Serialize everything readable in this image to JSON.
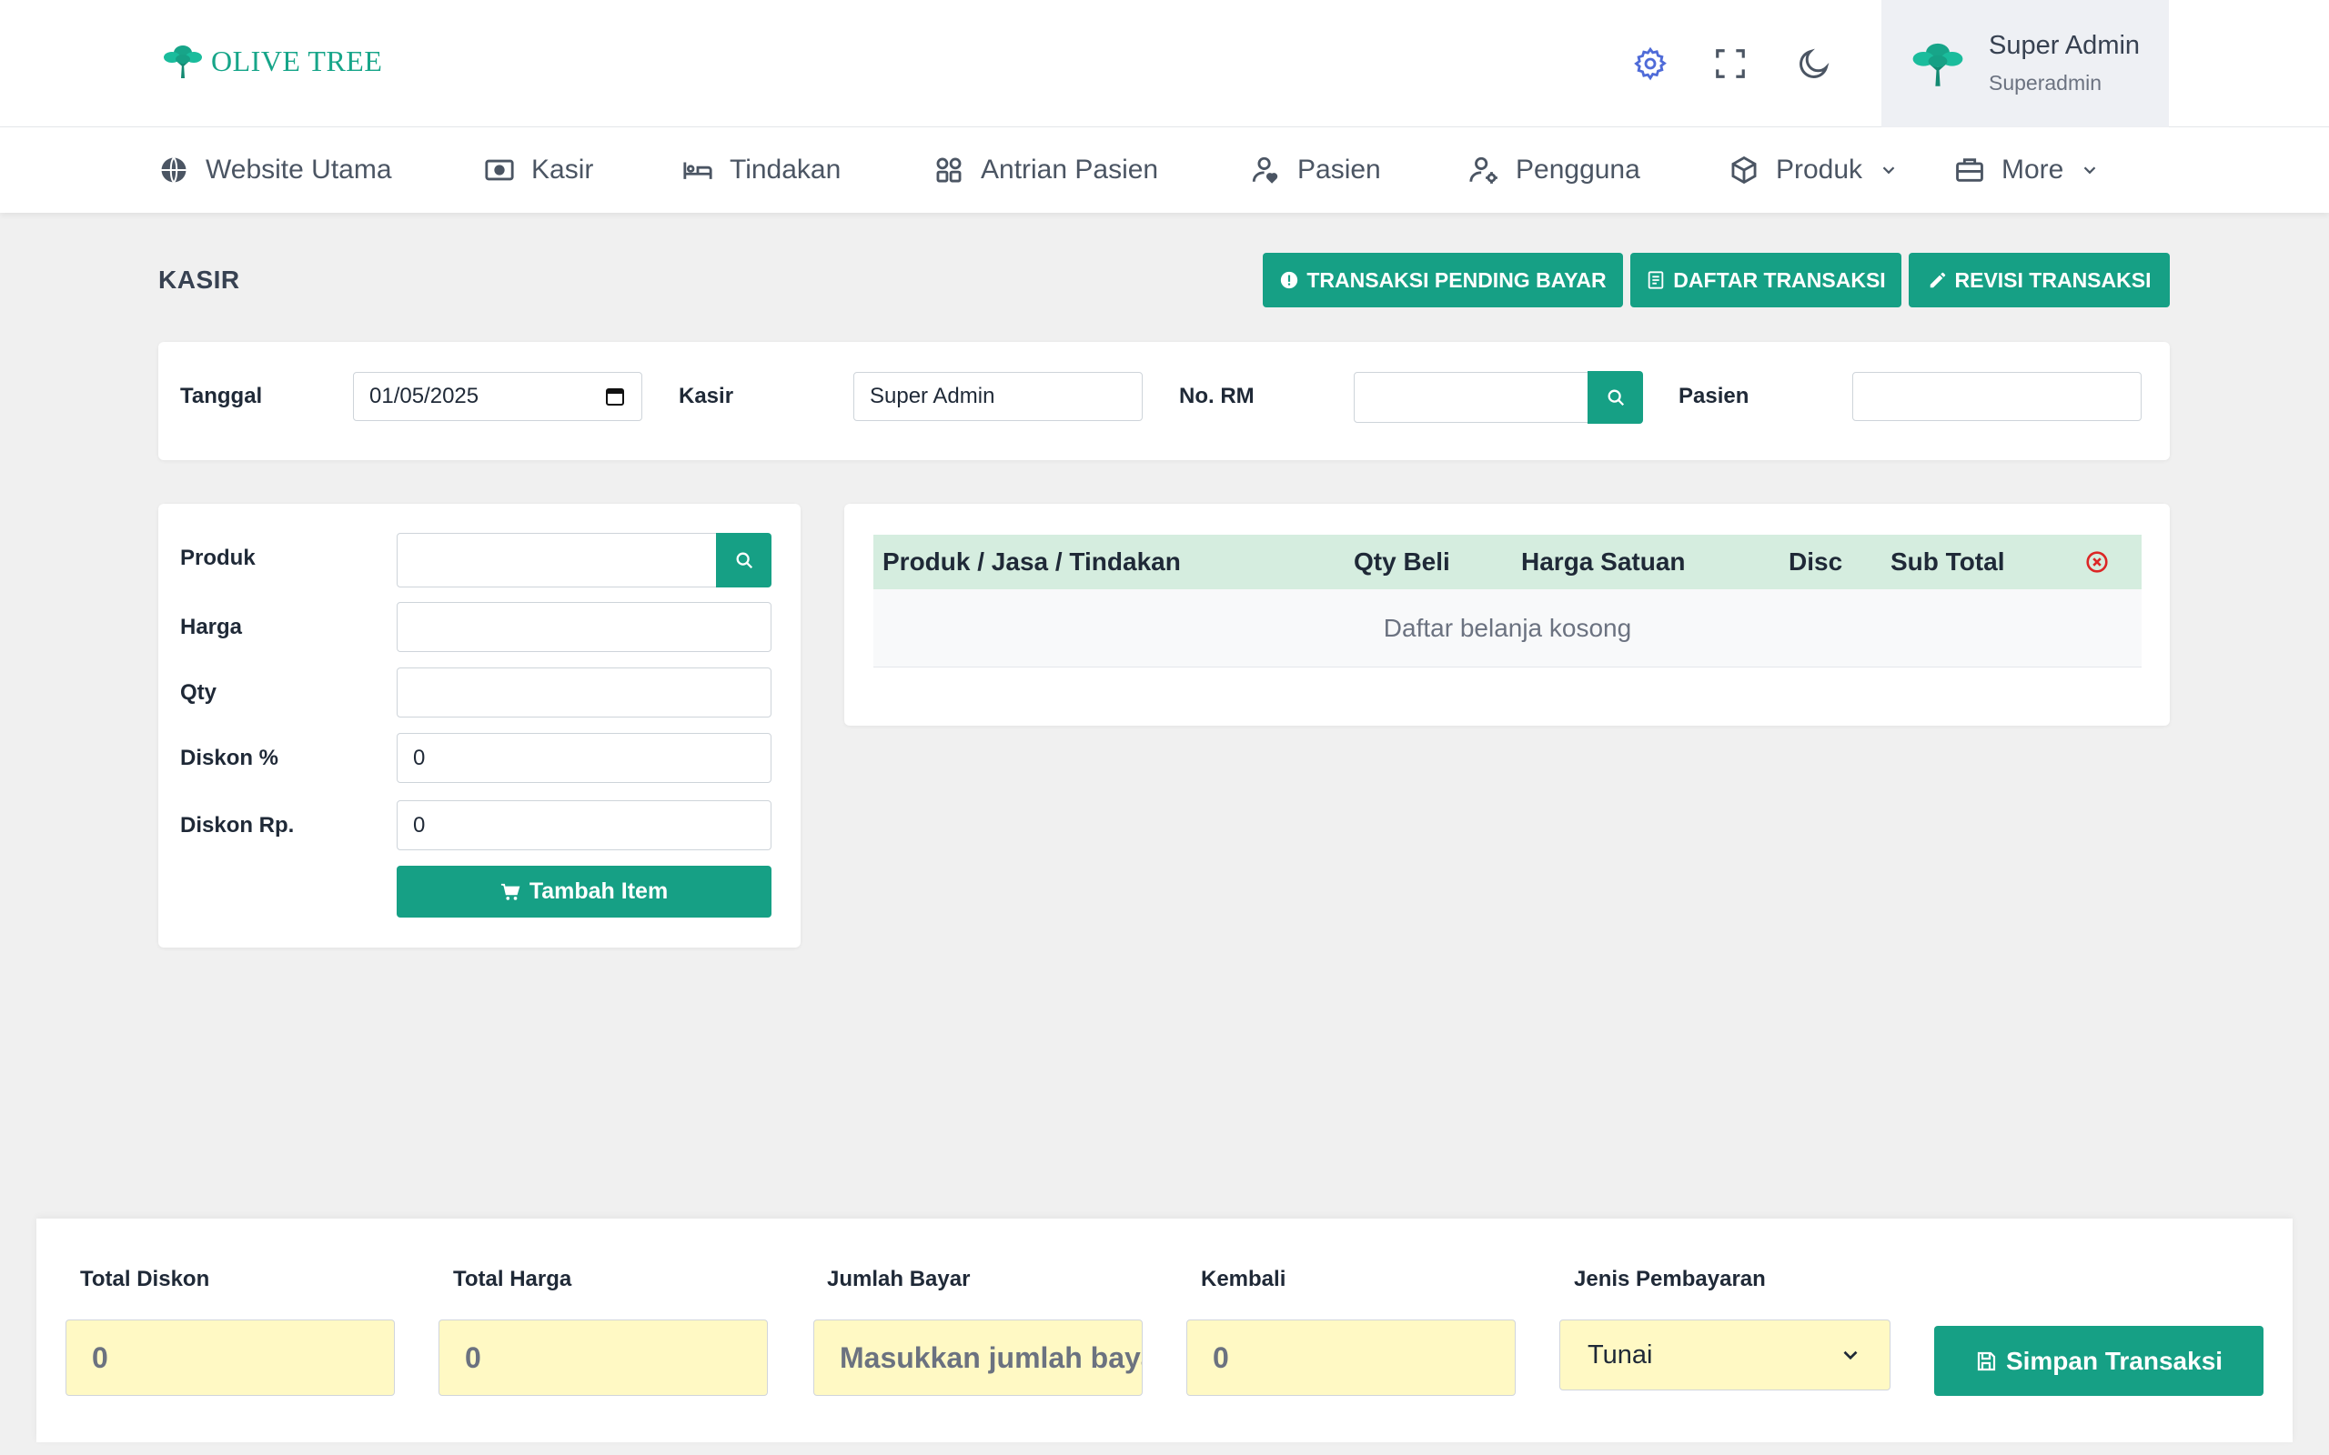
{
  "brand": {
    "name": "OLIVE TREE",
    "accent": "#16a085"
  },
  "header": {
    "icons": [
      "gear-icon",
      "fullscreen-icon",
      "moon-icon"
    ],
    "user": {
      "name": "Super Admin",
      "role": "Superadmin"
    }
  },
  "nav": {
    "items": [
      {
        "label": "Website Utama",
        "icon": "globe-icon"
      },
      {
        "label": "Kasir",
        "icon": "cash-icon"
      },
      {
        "label": "Tindakan",
        "icon": "bed-icon"
      },
      {
        "label": "Antrian Pasien",
        "icon": "grid-icon"
      },
      {
        "label": "Pasien",
        "icon": "user-heart-icon"
      },
      {
        "label": "Pengguna",
        "icon": "user-gear-icon"
      },
      {
        "label": "Produk",
        "icon": "box-icon"
      },
      {
        "label": "More",
        "icon": "briefcase-icon"
      }
    ]
  },
  "page": {
    "title": "KASIR",
    "actions": {
      "pending": "TRANSAKSI PENDING BAYAR",
      "list": "DAFTAR TRANSAKSI",
      "revise": "REVISI TRANSAKSI"
    }
  },
  "filters": {
    "tanggal_label": "Tanggal",
    "tanggal_value": "01/05/2025",
    "kasir_label": "Kasir",
    "kasir_value": "Super Admin",
    "rm_label": "No. RM",
    "rm_value": "",
    "pasien_label": "Pasien",
    "pasien_value": ""
  },
  "item_form": {
    "produk_label": "Produk",
    "produk_value": "",
    "harga_label": "Harga",
    "harga_value": "",
    "qty_label": "Qty",
    "qty_value": "",
    "diskon_pct_label": "Diskon %",
    "diskon_pct_value": "0",
    "diskon_rp_label": "Diskon Rp.",
    "diskon_rp_value": "0",
    "add_button": "Tambah Item"
  },
  "cart": {
    "columns": [
      "Produk / Jasa / Tindakan",
      "Qty Beli",
      "Harga Satuan",
      "Disc",
      "Sub Total"
    ],
    "empty_text": "Daftar belanja kosong"
  },
  "summary": {
    "total_diskon_label": "Total Diskon",
    "total_diskon_value": "0",
    "total_harga_label": "Total Harga",
    "total_harga_value": "0",
    "jumlah_bayar_label": "Jumlah Bayar",
    "jumlah_bayar_placeholder": "Masukkan jumlah bayar",
    "kembali_label": "Kembali",
    "kembali_value": "0",
    "jenis_label": "Jenis Pembayaran",
    "jenis_value": "Tunai",
    "save_button": "Simpan Transaksi"
  }
}
